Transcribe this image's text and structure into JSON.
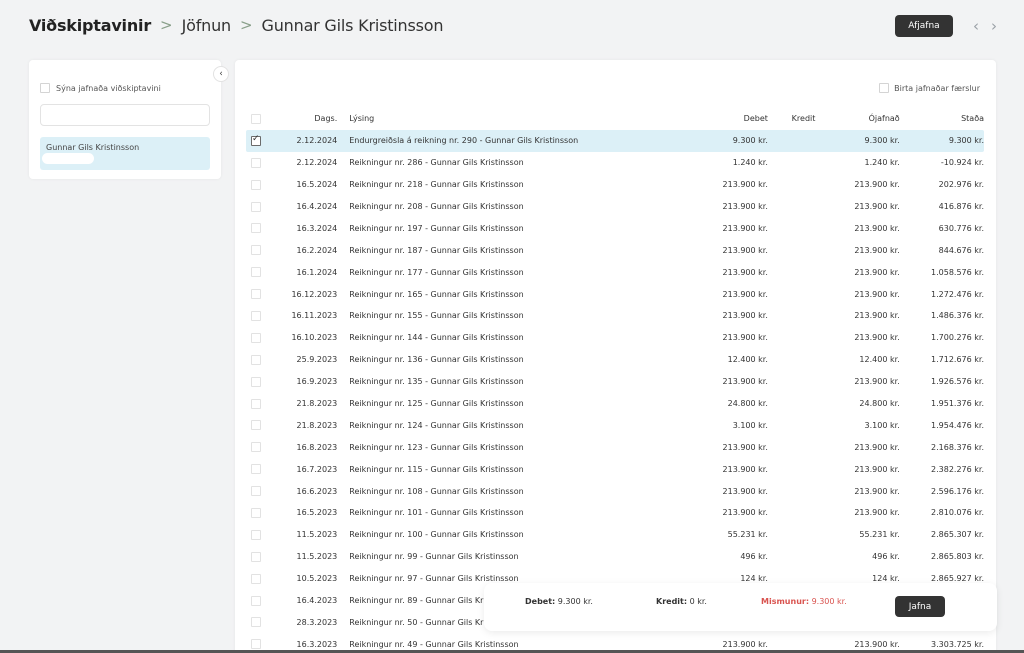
{
  "breadcrumb": {
    "root": "Viðskiptavinir",
    "section": "Jöfnun",
    "customer": "Gunnar Gils Kristinsson"
  },
  "header": {
    "unreconcile_button": "Afjafna",
    "prev_icon": "chevron-left-icon",
    "next_icon": "chevron-right-icon"
  },
  "sidebar": {
    "show_reconciled_label": "Sýna jafnaða viðskiptavini",
    "search_value": "",
    "selected_customer": "Gunnar Gils Kristinsson"
  },
  "main": {
    "show_reconciled_entries_label": "Birta jafnaðar færslur",
    "columns": {
      "date": "Dags.",
      "description": "Lýsing",
      "debet": "Debet",
      "kredit": "Kredit",
      "unreconciled": "Ójafnað",
      "balance": "Staða"
    },
    "rows": [
      {
        "checked": true,
        "date": "2.12.2024",
        "desc": "Endurgreiðsla á reikning nr. 290 - Gunnar Gils Kristinsson",
        "debet": "9.300 kr.",
        "kredit": "",
        "ojafn": "9.300 kr.",
        "stada": "9.300 kr."
      },
      {
        "checked": false,
        "date": "2.12.2024",
        "desc": "Reikningur nr. 286 - Gunnar Gils Kristinsson",
        "debet": "1.240 kr.",
        "kredit": "",
        "ojafn": "1.240 kr.",
        "stada": "-10.924 kr."
      },
      {
        "checked": false,
        "date": "16.5.2024",
        "desc": "Reikningur nr. 218 - Gunnar Gils Kristinsson",
        "debet": "213.900 kr.",
        "kredit": "",
        "ojafn": "213.900 kr.",
        "stada": "202.976 kr."
      },
      {
        "checked": false,
        "date": "16.4.2024",
        "desc": "Reikningur nr. 208 - Gunnar Gils Kristinsson",
        "debet": "213.900 kr.",
        "kredit": "",
        "ojafn": "213.900 kr.",
        "stada": "416.876 kr."
      },
      {
        "checked": false,
        "date": "16.3.2024",
        "desc": "Reikningur nr. 197 - Gunnar Gils Kristinsson",
        "debet": "213.900 kr.",
        "kredit": "",
        "ojafn": "213.900 kr.",
        "stada": "630.776 kr."
      },
      {
        "checked": false,
        "date": "16.2.2024",
        "desc": "Reikningur nr. 187 - Gunnar Gils Kristinsson",
        "debet": "213.900 kr.",
        "kredit": "",
        "ojafn": "213.900 kr.",
        "stada": "844.676 kr."
      },
      {
        "checked": false,
        "date": "16.1.2024",
        "desc": "Reikningur nr. 177 - Gunnar Gils Kristinsson",
        "debet": "213.900 kr.",
        "kredit": "",
        "ojafn": "213.900 kr.",
        "stada": "1.058.576 kr."
      },
      {
        "checked": false,
        "date": "16.12.2023",
        "desc": "Reikningur nr. 165 - Gunnar Gils Kristinsson",
        "debet": "213.900 kr.",
        "kredit": "",
        "ojafn": "213.900 kr.",
        "stada": "1.272.476 kr."
      },
      {
        "checked": false,
        "date": "16.11.2023",
        "desc": "Reikningur nr. 155 - Gunnar Gils Kristinsson",
        "debet": "213.900 kr.",
        "kredit": "",
        "ojafn": "213.900 kr.",
        "stada": "1.486.376 kr."
      },
      {
        "checked": false,
        "date": "16.10.2023",
        "desc": "Reikningur nr. 144 - Gunnar Gils Kristinsson",
        "debet": "213.900 kr.",
        "kredit": "",
        "ojafn": "213.900 kr.",
        "stada": "1.700.276 kr."
      },
      {
        "checked": false,
        "date": "25.9.2023",
        "desc": "Reikningur nr. 136 - Gunnar Gils Kristinsson",
        "debet": "12.400 kr.",
        "kredit": "",
        "ojafn": "12.400 kr.",
        "stada": "1.712.676 kr."
      },
      {
        "checked": false,
        "date": "16.9.2023",
        "desc": "Reikningur nr. 135 - Gunnar Gils Kristinsson",
        "debet": "213.900 kr.",
        "kredit": "",
        "ojafn": "213.900 kr.",
        "stada": "1.926.576 kr."
      },
      {
        "checked": false,
        "date": "21.8.2023",
        "desc": "Reikningur nr. 125 - Gunnar Gils Kristinsson",
        "debet": "24.800 kr.",
        "kredit": "",
        "ojafn": "24.800 kr.",
        "stada": "1.951.376 kr."
      },
      {
        "checked": false,
        "date": "21.8.2023",
        "desc": "Reikningur nr. 124 - Gunnar Gils Kristinsson",
        "debet": "3.100 kr.",
        "kredit": "",
        "ojafn": "3.100 kr.",
        "stada": "1.954.476 kr."
      },
      {
        "checked": false,
        "date": "16.8.2023",
        "desc": "Reikningur nr. 123 - Gunnar Gils Kristinsson",
        "debet": "213.900 kr.",
        "kredit": "",
        "ojafn": "213.900 kr.",
        "stada": "2.168.376 kr."
      },
      {
        "checked": false,
        "date": "16.7.2023",
        "desc": "Reikningur nr. 115 - Gunnar Gils Kristinsson",
        "debet": "213.900 kr.",
        "kredit": "",
        "ojafn": "213.900 kr.",
        "stada": "2.382.276 kr."
      },
      {
        "checked": false,
        "date": "16.6.2023",
        "desc": "Reikningur nr. 108 - Gunnar Gils Kristinsson",
        "debet": "213.900 kr.",
        "kredit": "",
        "ojafn": "213.900 kr.",
        "stada": "2.596.176 kr."
      },
      {
        "checked": false,
        "date": "16.5.2023",
        "desc": "Reikningur nr. 101 - Gunnar Gils Kristinsson",
        "debet": "213.900 kr.",
        "kredit": "",
        "ojafn": "213.900 kr.",
        "stada": "2.810.076 kr."
      },
      {
        "checked": false,
        "date": "11.5.2023",
        "desc": "Reikningur nr. 100 - Gunnar Gils Kristinsson",
        "debet": "55.231 kr.",
        "kredit": "",
        "ojafn": "55.231 kr.",
        "stada": "2.865.307 kr."
      },
      {
        "checked": false,
        "date": "11.5.2023",
        "desc": "Reikningur nr. 99 - Gunnar Gils Kristinsson",
        "debet": "496 kr.",
        "kredit": "",
        "ojafn": "496 kr.",
        "stada": "2.865.803 kr."
      },
      {
        "checked": false,
        "date": "10.5.2023",
        "desc": "Reikningur nr. 97 - Gunnar Gils Kristinsson",
        "debet": "124 kr.",
        "kredit": "",
        "ojafn": "124 kr.",
        "stada": "2.865.927 kr."
      },
      {
        "checked": false,
        "date": "16.4.2023",
        "desc": "Reikningur nr. 89 - Gunnar Gils Kr",
        "debet": "",
        "kredit": "",
        "ojafn": "",
        "stada": ""
      },
      {
        "checked": false,
        "date": "28.3.2023",
        "desc": "Reikningur nr. 50 - Gunnar Gils Kr",
        "debet": "",
        "kredit": "",
        "ojafn": "",
        "stada": ""
      },
      {
        "checked": false,
        "date": "16.3.2023",
        "desc": "Reikningur nr. 49 - Gunnar Gils Kristinsson",
        "debet": "213.900 kr.",
        "kredit": "",
        "ojafn": "213.900 kr.",
        "stada": "3.303.725 kr."
      }
    ]
  },
  "footer": {
    "debet_label": "Debet:",
    "debet_value": "9.300 kr.",
    "kredit_label": "Kredit:",
    "kredit_value": "0 kr.",
    "diff_label": "Mismunur:",
    "diff_value": "9.300 kr.",
    "reconcile_button": "Jafna"
  },
  "colors": {
    "selected_row": "#dcf0f7",
    "dark_button": "#333333",
    "diff_red": "#d9534f"
  }
}
